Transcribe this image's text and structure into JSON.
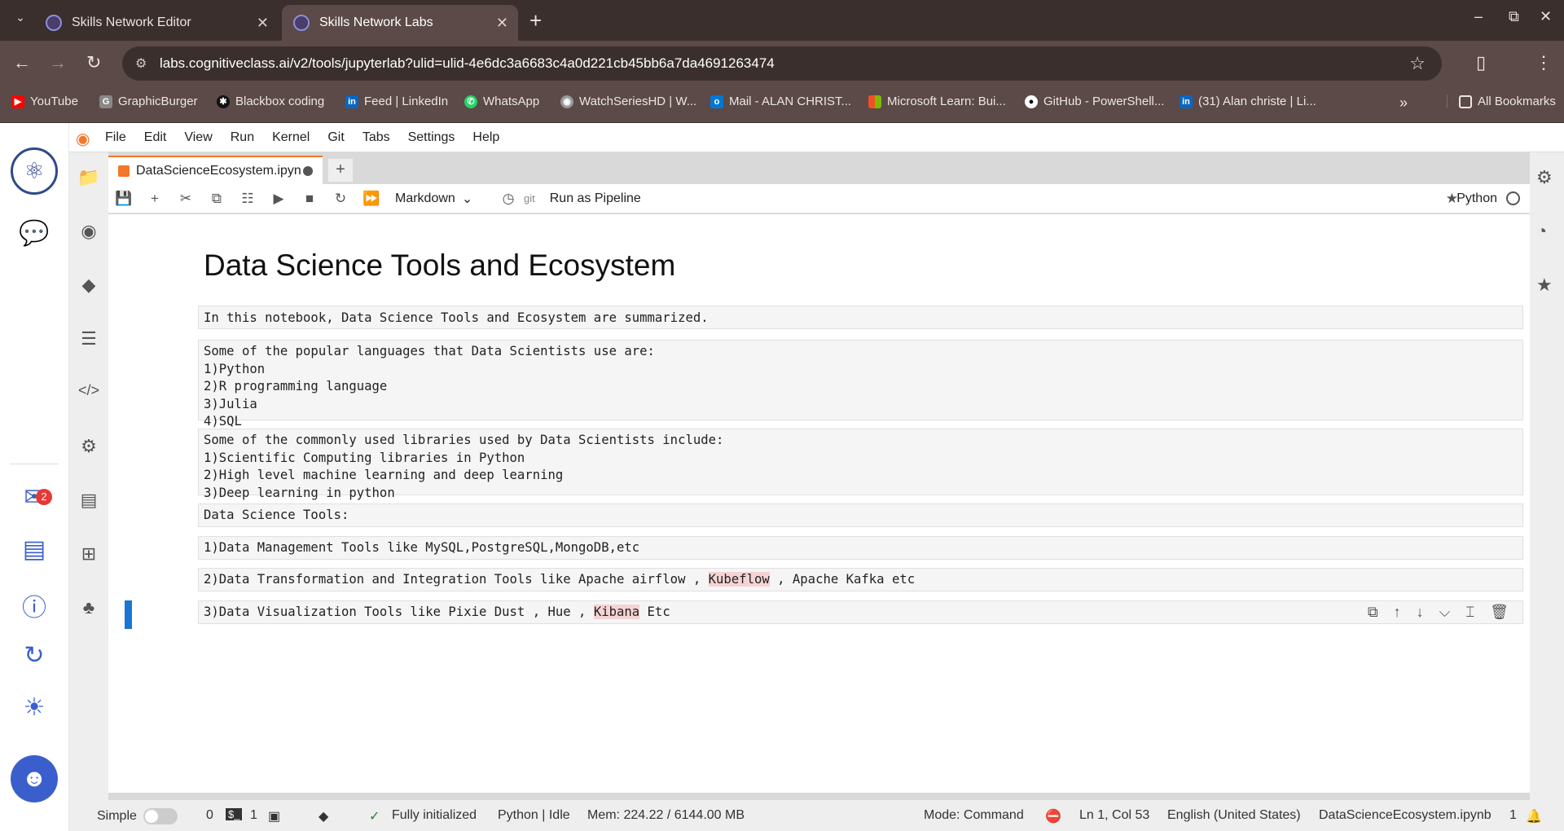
{
  "browser": {
    "tabs": [
      {
        "title": "Skills Network Editor",
        "active": false
      },
      {
        "title": "Skills Network Labs",
        "active": true
      }
    ],
    "url": "labs.cognitiveclass.ai/v2/tools/jupyterlab?ulid=ulid-4e6dc3a6683c4a0d221cb45bb6a7da4691263474",
    "bookmarks": [
      {
        "label": "YouTube",
        "icon": "youtube-icon",
        "color": "#ff0000"
      },
      {
        "label": "GraphicBurger",
        "icon": "graphicburger-icon",
        "color": "#cccccc"
      },
      {
        "label": "Blackbox coding",
        "icon": "blackbox-icon",
        "color": "#111111"
      },
      {
        "label": "Feed | LinkedIn",
        "icon": "linkedin-icon",
        "color": "#0a66c2"
      },
      {
        "label": "WhatsApp",
        "icon": "whatsapp-icon",
        "color": "#25d366"
      },
      {
        "label": "WatchSeriesHD | W...",
        "icon": "globe-icon",
        "color": "#bbbbbb"
      },
      {
        "label": "Mail - ALAN CHRIST...",
        "icon": "outlook-icon",
        "color": "#0078d4"
      },
      {
        "label": "Microsoft Learn: Bui...",
        "icon": "microsoft-icon",
        "color": "#f25022"
      },
      {
        "label": "GitHub - PowerShell...",
        "icon": "github-icon",
        "color": "#ffffff"
      },
      {
        "label": "(31) Alan christe | Li...",
        "icon": "linkedin-icon",
        "color": "#0a66c2"
      }
    ],
    "all_bookmarks": "All Bookmarks"
  },
  "jupyter": {
    "menu": [
      "File",
      "Edit",
      "View",
      "Run",
      "Kernel",
      "Git",
      "Tabs",
      "Settings",
      "Help"
    ],
    "doc_tab": "DataScienceEcosystem.ipyn",
    "toolbar": {
      "cell_type": "Markdown",
      "git": "git",
      "run_pipeline": "Run as Pipeline",
      "kernel": "Python"
    },
    "notebook": {
      "title": "Data Science Tools and Ecosystem",
      "intro": "In this notebook, Data Science Tools and Ecosystem are summarized.",
      "languages": "Some of the popular languages that Data Scientists use are:\n1)Python\n2)R programming language\n3)Julia\n4)SQL",
      "libraries": "Some of the commonly used libraries used by Data Scientists include:\n1)Scientific Computing libraries in Python\n2)High level machine learning and deep learning\n3)Deep learning in python",
      "tools_heading": "Data Science Tools:",
      "tool1": "1)Data Management Tools like MySQL,PostgreSQL,MongoDB,etc",
      "tool2_a": "2)Data Transformation and Integration Tools like Apache airflow , ",
      "tool2_hl": "Kubeflow",
      "tool2_b": " , Apache Kafka etc",
      "tool3_a": "3)Data Visualization Tools like Pixie Dust , Hue , ",
      "tool3_hl": "Kibana",
      "tool3_b": " Etc"
    },
    "status": {
      "mode_simple": "Simple",
      "terminals": "0",
      "kernels": "1",
      "initialized": "Fully initialized",
      "kernel_status": "Python | Idle",
      "memory": "Mem: 224.22 / 6144.00 MB",
      "mode": "Mode: Command",
      "position": "Ln 1, Col 53",
      "language": "English (United States)",
      "filename": "DataScienceEcosystem.ipynb",
      "notifications": "1"
    },
    "inbox_badge": "2"
  }
}
